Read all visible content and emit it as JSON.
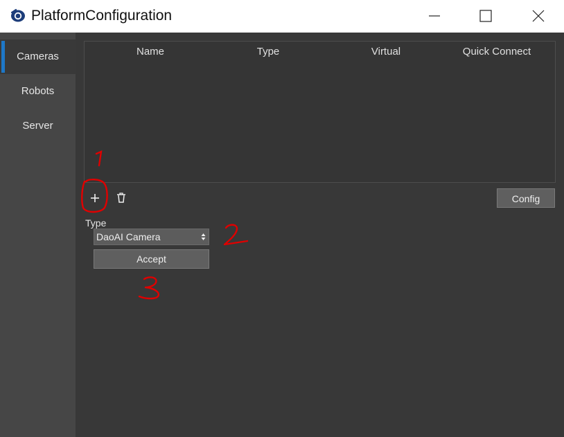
{
  "window": {
    "title": "PlatformConfiguration",
    "app_icon": "eye-logo-icon",
    "controls": [
      "minimize-icon",
      "maximize-icon",
      "close-icon"
    ]
  },
  "sidebar": {
    "items": [
      {
        "label": "Cameras",
        "active": true
      },
      {
        "label": "Robots",
        "active": false
      },
      {
        "label": "Server",
        "active": false
      }
    ],
    "accent_color": "#1e78c8"
  },
  "table": {
    "columns": [
      "Name",
      "Type",
      "Virtual",
      "Quick Connect"
    ],
    "rows": []
  },
  "toolbar": {
    "add_icon": "plus-icon",
    "delete_icon": "trash-icon",
    "config_label": "Config"
  },
  "form": {
    "type_label": "Type",
    "type_value": "DaoAI Camera",
    "accept_label": "Accept"
  },
  "annotations": {
    "labels": [
      "1",
      "2",
      "3"
    ],
    "color": "#e00000"
  }
}
